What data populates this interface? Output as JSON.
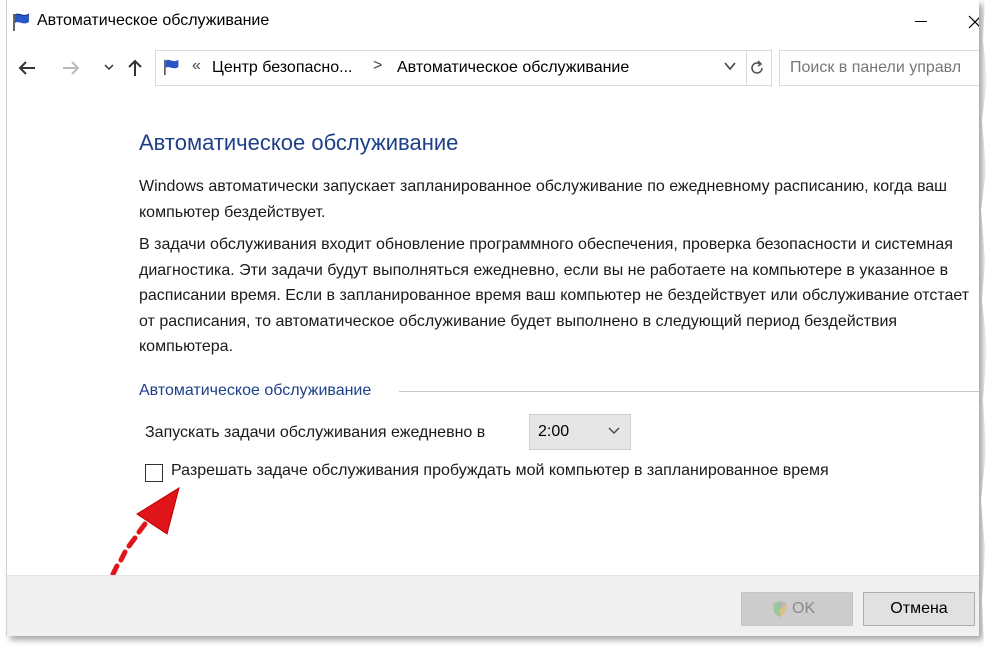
{
  "window": {
    "title": "Автоматическое обслуживание"
  },
  "address_bar": {
    "separator1": "«",
    "crumbs": [
      "Центр безопасно...",
      "Автоматическое обслуживание"
    ],
    "separator2": ">"
  },
  "search": {
    "placeholder": "Поиск в панели управл"
  },
  "content": {
    "heading": "Автоматическое обслуживание",
    "paragraph1": "Windows автоматически запускает запланированное обслуживание по ежедневному расписанию, когда ваш компьютер бездействует.",
    "paragraph2": "В задачи обслуживания входит обновление программного обеспечения, проверка безопасности и системная диагностика. Эти задачи будут выполняться ежедневно, если вы не работаете на компьютере в указанное в расписании время. Если в запланированное время ваш компьютер не бездействует или обслуживание отстает от расписания, то автоматическое обслуживание будет выполнено в следующий период бездействия компьютера.",
    "group_title": "Автоматическое обслуживание",
    "run_label": "Запускать задачи обслуживания ежедневно в",
    "time_value": "2:00",
    "wake_checkbox_label": "Разрешать задаче обслуживания пробуждать мой компьютер в запланированное время",
    "wake_checkbox_checked": false
  },
  "footer": {
    "ok_label": "OK",
    "cancel_label": "Отмена"
  },
  "colors": {
    "heading_blue": "#1e3f8a",
    "arrow_red": "#e0151b",
    "footer_bg": "#f0f0f0"
  },
  "icons": [
    "flag-icon",
    "back-arrow-icon",
    "forward-arrow-icon",
    "chevron-down-icon",
    "up-arrow-icon",
    "refresh-icon",
    "shield-icon",
    "red-arrow-icon"
  ]
}
